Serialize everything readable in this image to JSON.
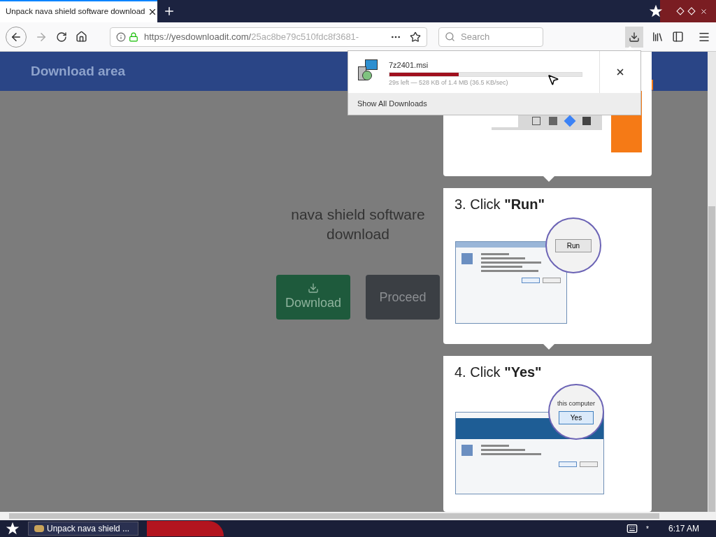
{
  "browser": {
    "tab": {
      "title": "Unpack nava shield software download",
      "selected": true
    },
    "url": {
      "domain": "https://yesdownloadit.com/",
      "path": "25ac8be79c510fdc8f3681-"
    },
    "search": {
      "placeholder": "Search"
    }
  },
  "downloads_panel": {
    "file": "7z2401.msi",
    "level": 0.36,
    "status": "29s left — 528 KB of 1.4 MB (36.5 KB/sec)",
    "footer": "Show All Downloads"
  },
  "page": {
    "header": "Download area",
    "title": "nava shield software download",
    "buttons": [
      {
        "kind": "download",
        "label": "Download"
      },
      {
        "kind": "proceed",
        "label": "Proceed"
      }
    ],
    "steps": [
      {
        "kind": "toolbar"
      },
      {
        "kind": "run",
        "number": "3.",
        "verb": "Click",
        "target": "\"Run\"",
        "zoom_button": "Run"
      },
      {
        "kind": "yes",
        "number": "4.",
        "verb": "Click",
        "target": "\"Yes\"",
        "zoom_caption": "this computer",
        "zoom_button": "Yes"
      }
    ]
  },
  "taskbar": {
    "task": "Unpack nava shield ...",
    "clock": "6:17 AM",
    "tray_mark": "*"
  }
}
